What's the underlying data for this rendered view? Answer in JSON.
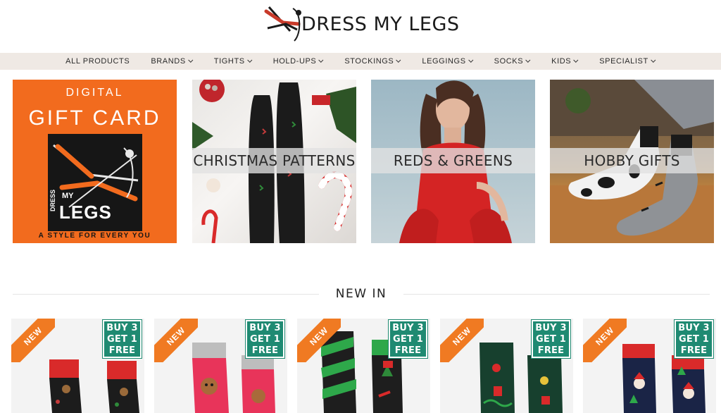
{
  "brand": {
    "name": "DRESS MY LEGS"
  },
  "nav": {
    "items": [
      {
        "label": "ALL PRODUCTS",
        "dropdown": false
      },
      {
        "label": "BRANDS",
        "dropdown": true
      },
      {
        "label": "TIGHTS",
        "dropdown": true
      },
      {
        "label": "HOLD-UPS",
        "dropdown": true
      },
      {
        "label": "STOCKINGS",
        "dropdown": true
      },
      {
        "label": "LEGGINGS",
        "dropdown": true
      },
      {
        "label": "SOCKS",
        "dropdown": true
      },
      {
        "label": "KIDS",
        "dropdown": true
      },
      {
        "label": "SPECIALIST",
        "dropdown": true
      }
    ]
  },
  "tiles": {
    "gift_card": {
      "top_label": "DIGITAL",
      "title": "GIFT CARD",
      "logo_small": "DRESS",
      "logo_my": "MY",
      "logo_big": "LEGS",
      "tagline": "A STYLE FOR EVERY YOU"
    },
    "christmas": {
      "label": "CHRISTMAS PATTERNS"
    },
    "reds": {
      "label": "REDS & GREENS"
    },
    "hobby": {
      "label": "HOBBY GIFTS"
    }
  },
  "new_in": {
    "title": "NEW IN"
  },
  "products": [
    {
      "badge": "NEW",
      "promo_line1": "BUY 3",
      "promo_line2": "GET 1",
      "promo_line3": "FREE"
    },
    {
      "badge": "NEW",
      "promo_line1": "BUY 3",
      "promo_line2": "GET 1",
      "promo_line3": "FREE"
    },
    {
      "badge": "NEW",
      "promo_line1": "BUY 3",
      "promo_line2": "GET 1",
      "promo_line3": "FREE"
    },
    {
      "badge": "NEW",
      "promo_line1": "BUY 3",
      "promo_line2": "GET 1",
      "promo_line3": "FREE"
    },
    {
      "badge": "NEW",
      "promo_line1": "BUY 3",
      "promo_line2": "GET 1",
      "promo_line3": "FREE"
    }
  ],
  "colors": {
    "nav_bg": "#efe9e4",
    "gift_orange": "#f26b1e",
    "badge_orange": "#f07a22",
    "promo_green": "#1f8a72"
  }
}
